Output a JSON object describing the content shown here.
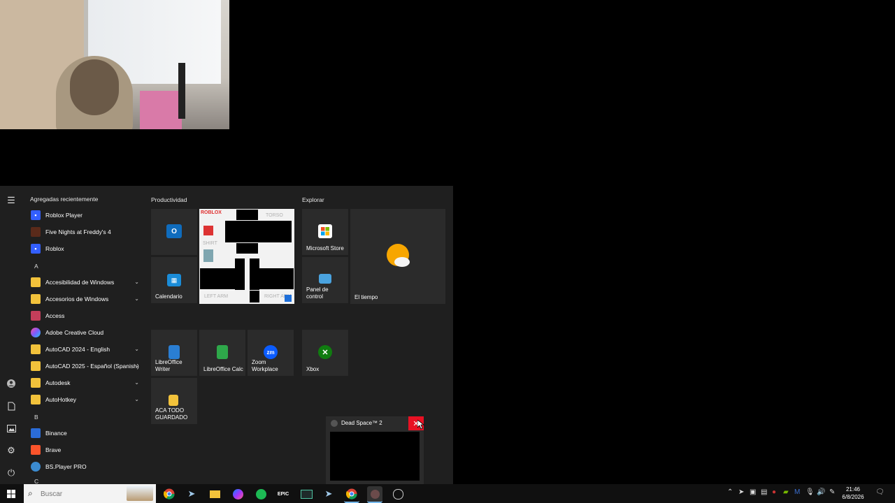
{
  "start_menu": {
    "recent_header": "Agregadas recientemente",
    "apps": [
      {
        "label": "Roblox Player",
        "icon": "roblox-icon",
        "color": "#335fff"
      },
      {
        "label": "Five Nights at Freddy's 4",
        "icon": "fnaf-icon",
        "color": "#5a2a1a"
      },
      {
        "label": "Roblox",
        "icon": "roblox-icon",
        "color": "#335fff"
      },
      {
        "label": "Accesibilidad de Windows",
        "icon": "folder-icon",
        "color": "#f2c23b",
        "expandable": true
      },
      {
        "label": "Accesorios de Windows",
        "icon": "folder-icon",
        "color": "#f2c23b",
        "expandable": true
      },
      {
        "label": "Access",
        "icon": "access-icon",
        "color": "#c43e5a"
      },
      {
        "label": "Adobe Creative Cloud",
        "icon": "creative-cloud-icon",
        "color": "#da1f26"
      },
      {
        "label": "AutoCAD 2024 - English",
        "icon": "folder-icon",
        "color": "#f2c23b",
        "expandable": true
      },
      {
        "label": "AutoCAD 2025 - Español (Spanish)",
        "icon": "folder-icon",
        "color": "#f2c23b",
        "expandable": true
      },
      {
        "label": "Autodesk",
        "icon": "folder-icon",
        "color": "#f2c23b",
        "expandable": true
      },
      {
        "label": "AutoHotkey",
        "icon": "folder-icon",
        "color": "#f2c23b",
        "expandable": true
      },
      {
        "label": "Binance",
        "icon": "binance-icon",
        "color": "#2b6cd8"
      },
      {
        "label": "Brave",
        "icon": "brave-icon",
        "color": "#fb542b"
      },
      {
        "label": "BS.Player PRO",
        "icon": "bsplayer-icon",
        "color": "#3b8bd0"
      }
    ],
    "letters": [
      "A",
      "B",
      "C"
    ],
    "groups": {
      "productivity": "Productividad",
      "explore": "Explorar"
    },
    "tiles": {
      "outlook": "",
      "calendario": "Calendario",
      "store": "Microsoft Store",
      "control_panel": "Panel de\ncontrol",
      "weather": "El tiempo",
      "writer": "LibreOffice\nWriter",
      "calc": "LibreOffice Calc",
      "zoom": "Zoom\nWorkplace",
      "xbox": "Xbox",
      "folder": "ACA TODO\nGUARDADO"
    },
    "template": {
      "brand": "ROBLOX",
      "torso": "TORSO",
      "shirt": "SHIRT",
      "left_arm": "LEFT ARM",
      "right_arm": "RIGHT ARM"
    }
  },
  "preview": {
    "title": "Dead Space™ 2"
  },
  "taskbar": {
    "search_placeholder": "Buscar",
    "clock_time": "21:46",
    "clock_date": "6/8/2026"
  }
}
